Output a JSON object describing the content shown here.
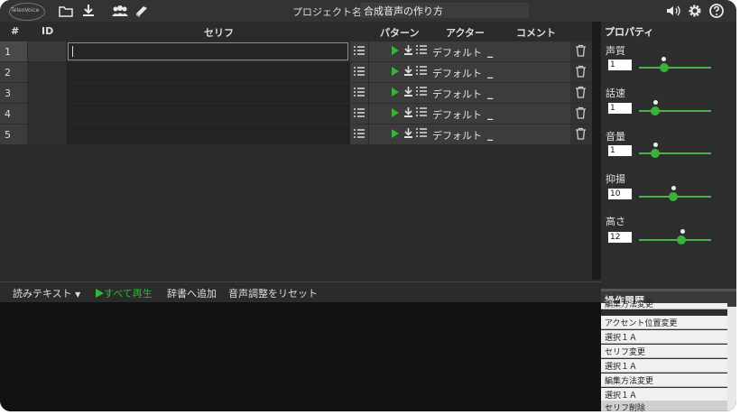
{
  "app": {
    "logo_text": "TeleoVoice"
  },
  "toolbar": {
    "project_label": "プロジェクト名",
    "project_name": "合成音声の作り方"
  },
  "table": {
    "headers": {
      "num": "#",
      "id": "ID",
      "serif": "セリフ",
      "pattern": "パターン",
      "actor": "アクター",
      "comment": "コメント"
    },
    "rows": [
      {
        "num": "1",
        "actor": "デフォルト"
      },
      {
        "num": "2",
        "actor": "デフォルト"
      },
      {
        "num": "3",
        "actor": "デフォルト"
      },
      {
        "num": "4",
        "actor": "デフォルト"
      },
      {
        "num": "5",
        "actor": "デフォルト"
      }
    ]
  },
  "bottom_toolbar": {
    "read_text": "読みテキスト",
    "play_all": "すべて再生",
    "add_dict": "辞書へ追加",
    "reset_voice": "音声調整をリセット"
  },
  "properties": {
    "title": "プロパティ",
    "items": [
      {
        "label": "声質",
        "value": "1"
      },
      {
        "label": "話速",
        "value": "1"
      },
      {
        "label": "音量",
        "value": "1"
      },
      {
        "label": "抑揚",
        "value": "10"
      },
      {
        "label": "高さ",
        "value": "12"
      }
    ]
  },
  "history": {
    "title": "操作履歴",
    "items": [
      "編集方法変更",
      "アクセント位置変更",
      "選択１Ａ",
      "セリフ変更",
      "選択１Ａ",
      "編集方法変更",
      "選択１Ａ",
      "セリフ削除"
    ]
  },
  "colors": {
    "accent": "#3ab23a",
    "background": "#2b2b2b"
  }
}
